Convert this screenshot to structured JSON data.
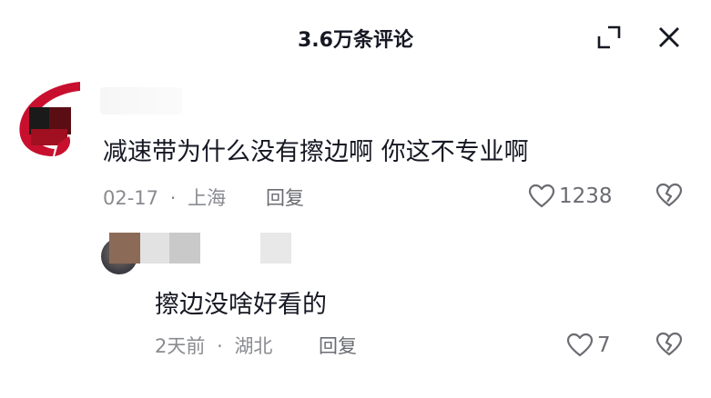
{
  "header": {
    "title": "3.6万条评论"
  },
  "icons": {
    "expand": "expand-icon",
    "close": "close-icon",
    "like": "heart-outline-icon",
    "dislike": "broken-heart-icon"
  },
  "colors": {
    "avatar_red": "#c8102e",
    "text_primary": "#161823",
    "text_secondary": "#8a8b91"
  },
  "comments": [
    {
      "text": "减速带为什么没有擦边啊  你这不专业啊",
      "date": "02-17",
      "separator": "·",
      "location": "上海",
      "reply_label": "回复",
      "likes": "1238"
    }
  ],
  "replies": [
    {
      "text": "擦边没啥好看的",
      "date": "2天前",
      "separator": "·",
      "location": "湖北",
      "reply_label": "回复",
      "likes": "7"
    }
  ]
}
